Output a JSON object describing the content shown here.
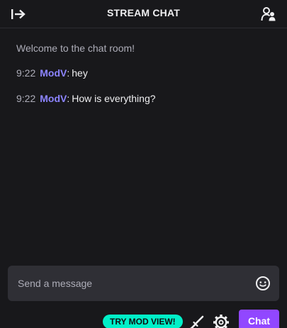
{
  "header": {
    "title": "STREAM CHAT",
    "collapse_icon": "collapse-arrow-icon",
    "users_icon": "community-users-icon"
  },
  "chat": {
    "welcome": "Welcome to the chat room!",
    "messages": [
      {
        "time": "9:22",
        "user": "ModV",
        "text": "hey"
      },
      {
        "time": "9:22",
        "user": "ModV",
        "text": "How is everything?"
      }
    ]
  },
  "composer": {
    "placeholder": "Send a message",
    "emote_icon": "smiley-emote-icon"
  },
  "footer": {
    "mod_view_label": "TRY MOD VIEW!",
    "sword_icon": "sword-icon",
    "settings_icon": "gear-icon",
    "chat_button_label": "Chat"
  },
  "colors": {
    "background": "#18181b",
    "username": "#8c84ff",
    "accent": "#9147ff",
    "mod_pill": "#00f0c8",
    "input_bg": "#2f2f35"
  }
}
